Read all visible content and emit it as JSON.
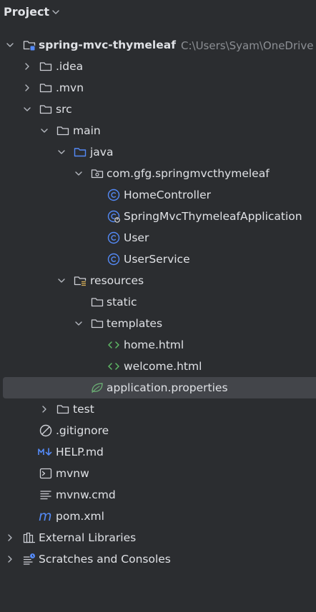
{
  "panel": {
    "title": "Project"
  },
  "colors": {
    "background": "#2b2d30",
    "selection": "#43454a",
    "text": "#dfe1e5",
    "muted": "#8c8f94",
    "folder_blue": "#548af7",
    "class_blue": "#548af7",
    "html_green": "#5fb865",
    "spring_green": "#6aab73"
  },
  "tree": {
    "root": {
      "label": "spring-mvc-thymeleaf",
      "path": "C:\\Users\\Syam\\OneDrive",
      "icon": "module-folder-icon"
    },
    "idea": {
      "label": ".idea",
      "icon": "folder-icon"
    },
    "mvn": {
      "label": ".mvn",
      "icon": "folder-icon"
    },
    "src": {
      "label": "src",
      "icon": "folder-icon"
    },
    "main": {
      "label": "main",
      "icon": "folder-icon"
    },
    "java": {
      "label": "java",
      "icon": "source-folder-icon"
    },
    "package": {
      "label": "com.gfg.springmvcthymeleaf",
      "icon": "package-icon"
    },
    "home_controller": {
      "label": "HomeController",
      "icon": "class-icon"
    },
    "app_class": {
      "label": "SpringMvcThymeleafApplication",
      "icon": "spring-boot-class-icon"
    },
    "user": {
      "label": "User",
      "icon": "class-icon"
    },
    "user_service": {
      "label": "UserService",
      "icon": "class-icon"
    },
    "resources": {
      "label": "resources",
      "icon": "resources-folder-icon"
    },
    "static": {
      "label": "static",
      "icon": "folder-icon"
    },
    "templates": {
      "label": "templates",
      "icon": "folder-icon"
    },
    "home_html": {
      "label": "home.html",
      "icon": "html-icon"
    },
    "welcome_html": {
      "label": "welcome.html",
      "icon": "html-icon"
    },
    "app_props": {
      "label": "application.properties",
      "icon": "spring-properties-icon"
    },
    "test": {
      "label": "test",
      "icon": "folder-icon"
    },
    "gitignore": {
      "label": ".gitignore",
      "icon": "ignored-file-icon"
    },
    "help_md": {
      "label": "HELP.md",
      "icon": "markdown-icon"
    },
    "mvnw": {
      "label": "mvnw",
      "icon": "shell-script-icon"
    },
    "mvnw_cmd": {
      "label": "mvnw.cmd",
      "icon": "text-file-icon"
    },
    "pom": {
      "label": "pom.xml",
      "icon": "maven-icon"
    },
    "external_libs": {
      "label": "External Libraries",
      "icon": "library-icon"
    },
    "scratches": {
      "label": "Scratches and Consoles",
      "icon": "scratches-icon"
    }
  }
}
